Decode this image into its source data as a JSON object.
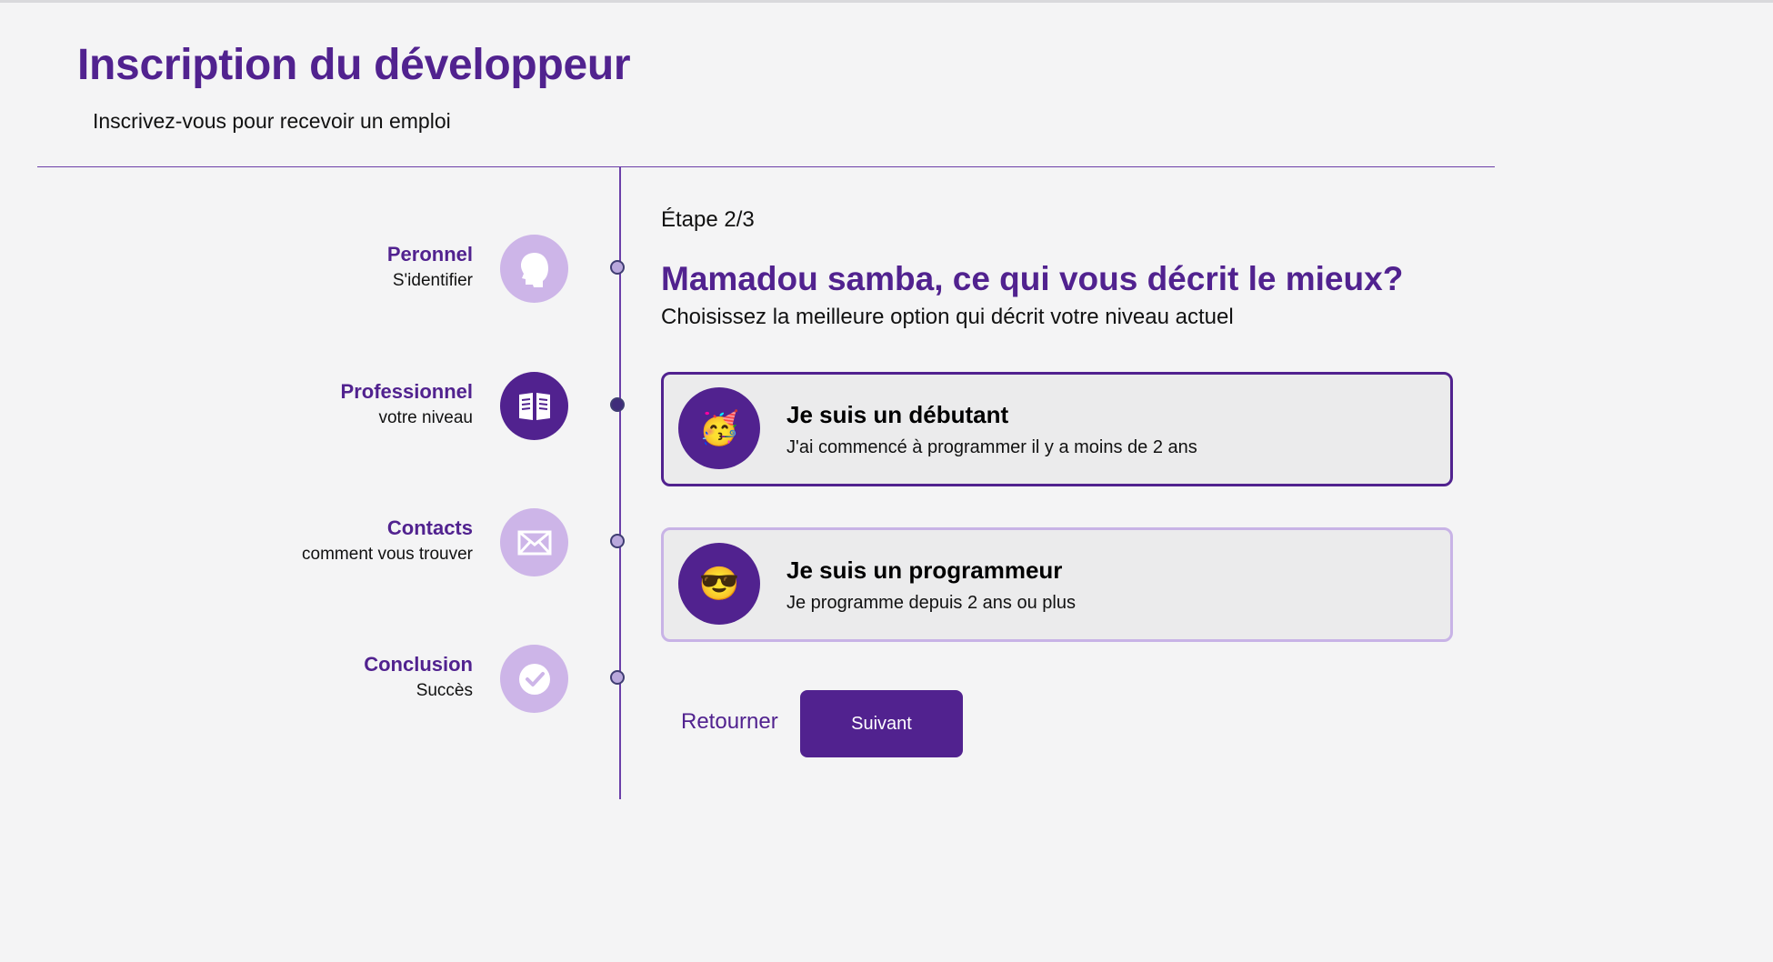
{
  "header": {
    "title": "Inscription du développeur",
    "subtitle": "Inscrivez-vous pour recevoir un emploi"
  },
  "steps": [
    {
      "name": "Peronnel",
      "description": "S'identifier",
      "icon": "head-icon",
      "active": false
    },
    {
      "name": "Professionnel",
      "description": "votre niveau",
      "icon": "book-icon",
      "active": true
    },
    {
      "name": "Contacts",
      "description": "comment vous trouver",
      "icon": "mail-icon",
      "active": false
    },
    {
      "name": "Conclusion",
      "description": "Succès",
      "icon": "check-icon",
      "active": false
    }
  ],
  "form": {
    "step_counter": "Étape 2/3",
    "question": "Mamadou samba, ce qui vous décrit le mieux?",
    "hint": "Choisissez la meilleure option qui décrit votre niveau actuel",
    "options": [
      {
        "emoji": "🥳",
        "title": "Je suis un débutant",
        "description": "J'ai commencé à programmer il y a moins de 2 ans",
        "selected": true
      },
      {
        "emoji": "😎",
        "title": "Je suis un programmeur",
        "description": "Je programme depuis 2 ans ou plus",
        "selected": false
      }
    ],
    "back_label": "Retourner",
    "next_label": "Suivant"
  },
  "colors": {
    "accent": "#51228f",
    "accent_light": "#cdb5e8",
    "background": "#f4f4f5",
    "card": "#ebebec"
  }
}
